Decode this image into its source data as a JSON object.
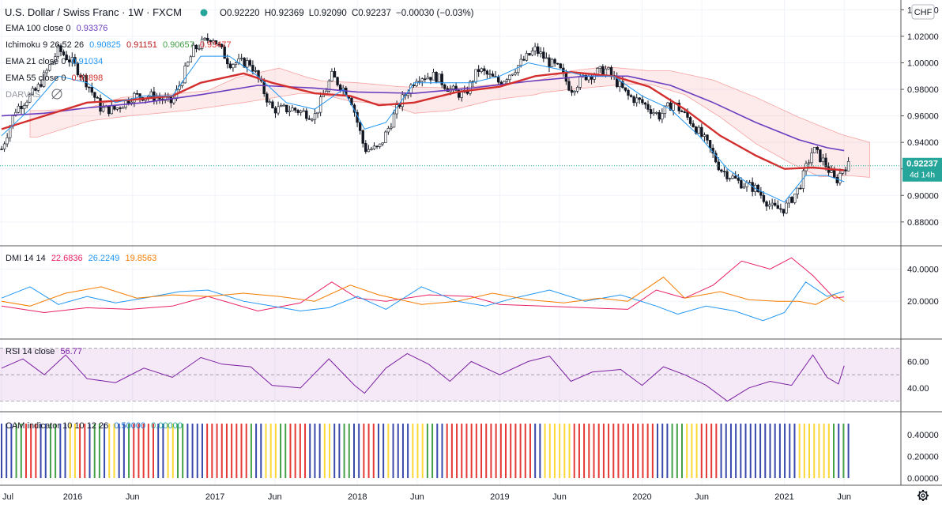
{
  "header": {
    "symbol": "U.S. Dollar / Swiss Franc · 1W · FXCM",
    "ohlc": {
      "o": "O0.92220",
      "h": "H0.92369",
      "l": "L0.92090",
      "c": "C0.92237",
      "change": "−0.00030 (−0.03%)"
    },
    "currency_badge": "CHF",
    "status_dot_color": "#26a69a"
  },
  "legends": {
    "ema100": {
      "label": "EMA 100 close 0",
      "value": "0.93376",
      "color": "#6a3dbf"
    },
    "ichimoku": {
      "label": "Ichimoku 9 26 52 26",
      "values": [
        "0.90825",
        "0.91151",
        "0.90657",
        "0.93477"
      ],
      "colors": [
        "#2196f3",
        "#b71c1c",
        "#43a047",
        "#e53935"
      ]
    },
    "ema21": {
      "label": "EMA 21 close 0",
      "value": "0.91034",
      "color": "#2196f3"
    },
    "ema55": {
      "label": "EMA 55 close 0",
      "value": "0.91898",
      "color": "#d32f2f"
    },
    "darvas": {
      "label": "DARVAS"
    },
    "dmi": {
      "label": "DMI 14 14",
      "values": [
        "22.6836",
        "26.2249",
        "19.8563"
      ],
      "colors": [
        "#e91e63",
        "#2196f3",
        "#f57c00"
      ]
    },
    "rsi": {
      "label": "RSI 14 close",
      "value": "56.77",
      "color": "#7b1fa2"
    },
    "cam": {
      "label": "CAM indicator 10 10 12 26",
      "values": [
        "0.50000",
        "0.00000"
      ],
      "colors": [
        "#1976d2",
        "#26a69a"
      ]
    }
  },
  "price_marker": {
    "value": "0.92237",
    "countdown": "4d 14h",
    "color": "#26a69a"
  },
  "x_axis": {
    "labels": [
      "Jul",
      "2016",
      "Jun",
      "2017",
      "Jun",
      "2018",
      "Jun",
      "2019",
      "Jun",
      "2020",
      "Jun",
      "2021",
      "Jun"
    ]
  },
  "settings_icon": "gear-icon",
  "chart_data": [
    {
      "type": "line",
      "panel": "price",
      "title": "U.S. Dollar / Swiss Franc · 1W · FXCM",
      "ylim": [
        0.865,
        1.045
      ],
      "y_ticks": [
        "1.04000",
        "1.02000",
        "1.00000",
        "0.98000",
        "0.96000",
        "0.94000",
        "0.92000",
        "0.90000",
        "0.88000"
      ],
      "y_tick_values": [
        1.04,
        1.02,
        1.0,
        0.98,
        0.96,
        0.94,
        0.92,
        0.9,
        0.88
      ],
      "time_anchors": [
        2015.5,
        2016.0,
        2016.42,
        2017.0,
        2017.42,
        2018.0,
        2018.42,
        2019.0,
        2019.42,
        2020.0,
        2020.42,
        2021.0,
        2021.42
      ],
      "time_range": [
        2015.5,
        2021.45
      ],
      "close": [
        [
          2015.5,
          0.935
        ],
        [
          2015.6,
          0.965
        ],
        [
          2015.75,
          0.98
        ],
        [
          2015.9,
          1.01
        ],
        [
          2016.0,
          1.0
        ],
        [
          2016.1,
          0.985
        ],
        [
          2016.2,
          0.965
        ],
        [
          2016.3,
          0.965
        ],
        [
          2016.42,
          0.975
        ],
        [
          2016.55,
          0.975
        ],
        [
          2016.7,
          0.97
        ],
        [
          2016.85,
          1.01
        ],
        [
          2016.98,
          1.02
        ],
        [
          2017.1,
          1.0
        ],
        [
          2017.25,
          1.0
        ],
        [
          2017.4,
          0.965
        ],
        [
          2017.55,
          0.965
        ],
        [
          2017.7,
          0.96
        ],
        [
          2017.82,
          0.99
        ],
        [
          2017.95,
          0.975
        ],
        [
          2018.05,
          0.935
        ],
        [
          2018.15,
          0.935
        ],
        [
          2018.3,
          0.97
        ],
        [
          2018.42,
          0.99
        ],
        [
          2018.55,
          0.99
        ],
        [
          2018.65,
          0.98
        ],
        [
          2018.75,
          0.975
        ],
        [
          2018.85,
          0.995
        ],
        [
          2019.0,
          0.985
        ],
        [
          2019.1,
          0.995
        ],
        [
          2019.25,
          1.01
        ],
        [
          2019.35,
          1.0
        ],
        [
          2019.42,
          0.995
        ],
        [
          2019.5,
          0.98
        ],
        [
          2019.6,
          0.99
        ],
        [
          2019.75,
          0.995
        ],
        [
          2019.9,
          0.975
        ],
        [
          2020.0,
          0.97
        ],
        [
          2020.12,
          0.96
        ],
        [
          2020.22,
          0.97
        ],
        [
          2020.35,
          0.955
        ],
        [
          2020.45,
          0.94
        ],
        [
          2020.55,
          0.92
        ],
        [
          2020.68,
          0.91
        ],
        [
          2020.8,
          0.905
        ],
        [
          2020.92,
          0.89
        ],
        [
          2021.0,
          0.89
        ],
        [
          2021.1,
          0.905
        ],
        [
          2021.2,
          0.935
        ],
        [
          2021.28,
          0.925
        ],
        [
          2021.36,
          0.91
        ],
        [
          2021.42,
          0.92237
        ]
      ],
      "ema21": [
        [
          2015.5,
          0.945
        ],
        [
          2015.7,
          0.965
        ],
        [
          2015.9,
          0.99
        ],
        [
          2016.1,
          0.985
        ],
        [
          2016.3,
          0.97
        ],
        [
          2016.5,
          0.975
        ],
        [
          2016.7,
          0.975
        ],
        [
          2016.9,
          1.005
        ],
        [
          2017.1,
          1.005
        ],
        [
          2017.3,
          0.99
        ],
        [
          2017.5,
          0.97
        ],
        [
          2017.7,
          0.965
        ],
        [
          2017.9,
          0.98
        ],
        [
          2018.05,
          0.95
        ],
        [
          2018.2,
          0.955
        ],
        [
          2018.4,
          0.985
        ],
        [
          2018.6,
          0.985
        ],
        [
          2018.8,
          0.985
        ],
        [
          2019.0,
          0.99
        ],
        [
          2019.2,
          1.0
        ],
        [
          2019.42,
          0.995
        ],
        [
          2019.6,
          0.99
        ],
        [
          2019.8,
          0.99
        ],
        [
          2020.0,
          0.975
        ],
        [
          2020.2,
          0.965
        ],
        [
          2020.4,
          0.945
        ],
        [
          2020.6,
          0.92
        ],
        [
          2020.8,
          0.905
        ],
        [
          2021.0,
          0.895
        ],
        [
          2021.15,
          0.915
        ],
        [
          2021.3,
          0.915
        ],
        [
          2021.42,
          0.91034
        ]
      ],
      "ema55": [
        [
          2015.5,
          0.95
        ],
        [
          2015.8,
          0.96
        ],
        [
          2016.1,
          0.97
        ],
        [
          2016.4,
          0.972
        ],
        [
          2016.7,
          0.975
        ],
        [
          2016.9,
          0.985
        ],
        [
          2017.2,
          0.992
        ],
        [
          2017.4,
          0.985
        ],
        [
          2017.7,
          0.977
        ],
        [
          2017.95,
          0.975
        ],
        [
          2018.15,
          0.968
        ],
        [
          2018.4,
          0.97
        ],
        [
          2018.7,
          0.978
        ],
        [
          2019.0,
          0.982
        ],
        [
          2019.25,
          0.99
        ],
        [
          2019.5,
          0.993
        ],
        [
          2019.8,
          0.99
        ],
        [
          2020.05,
          0.982
        ],
        [
          2020.3,
          0.965
        ],
        [
          2020.55,
          0.945
        ],
        [
          2020.8,
          0.93
        ],
        [
          2021.0,
          0.92
        ],
        [
          2021.2,
          0.921
        ],
        [
          2021.42,
          0.91898
        ]
      ],
      "ema100": [
        [
          2015.5,
          0.96
        ],
        [
          2015.8,
          0.962
        ],
        [
          2016.1,
          0.966
        ],
        [
          2016.5,
          0.97
        ],
        [
          2016.9,
          0.976
        ],
        [
          2017.3,
          0.983
        ],
        [
          2017.7,
          0.981
        ],
        [
          2018.0,
          0.978
        ],
        [
          2018.4,
          0.977
        ],
        [
          2018.8,
          0.981
        ],
        [
          2019.2,
          0.986
        ],
        [
          2019.6,
          0.99
        ],
        [
          2019.9,
          0.99
        ],
        [
          2020.2,
          0.983
        ],
        [
          2020.5,
          0.97
        ],
        [
          2020.8,
          0.955
        ],
        [
          2021.1,
          0.942
        ],
        [
          2021.3,
          0.936
        ],
        [
          2021.42,
          0.93376
        ]
      ]
    },
    {
      "type": "line",
      "panel": "dmi",
      "title": "DMI 14 14",
      "ylim": [
        0,
        52
      ],
      "y_ticks": [
        "40.0000",
        "20.0000"
      ],
      "y_tick_values": [
        40,
        20
      ],
      "series": [
        {
          "name": "22.6836",
          "color": "#e91e63",
          "values": [
            [
              2015.5,
              17
            ],
            [
              2015.8,
              13
            ],
            [
              2016.1,
              16
            ],
            [
              2016.4,
              15
            ],
            [
              2016.7,
              17
            ],
            [
              2016.95,
              23
            ],
            [
              2017.3,
              14
            ],
            [
              2017.6,
              19
            ],
            [
              2017.82,
              32
            ],
            [
              2018.0,
              22
            ],
            [
              2018.2,
              20
            ],
            [
              2018.5,
              24
            ],
            [
              2018.8,
              23
            ],
            [
              2019.0,
              18
            ],
            [
              2019.3,
              17
            ],
            [
              2019.6,
              16
            ],
            [
              2019.9,
              15
            ],
            [
              2020.1,
              27
            ],
            [
              2020.3,
              22
            ],
            [
              2020.5,
              30
            ],
            [
              2020.7,
              45
            ],
            [
              2020.9,
              40
            ],
            [
              2021.05,
              47
            ],
            [
              2021.2,
              36
            ],
            [
              2021.35,
              22
            ],
            [
              2021.42,
              22.68
            ]
          ]
        },
        {
          "name": "26.2249",
          "color": "#2196f3",
          "values": [
            [
              2015.5,
              22
            ],
            [
              2015.7,
              29
            ],
            [
              2015.9,
              18
            ],
            [
              2016.1,
              23
            ],
            [
              2016.3,
              19
            ],
            [
              2016.5,
              22
            ],
            [
              2016.75,
              26
            ],
            [
              2016.95,
              27
            ],
            [
              2017.2,
              20
            ],
            [
              2017.4,
              17
            ],
            [
              2017.6,
              14
            ],
            [
              2017.8,
              16
            ],
            [
              2018.0,
              23
            ],
            [
              2018.2,
              15
            ],
            [
              2018.45,
              29
            ],
            [
              2018.7,
              20
            ],
            [
              2018.9,
              17
            ],
            [
              2019.1,
              22
            ],
            [
              2019.35,
              27
            ],
            [
              2019.6,
              20
            ],
            [
              2019.85,
              24
            ],
            [
              2020.1,
              17
            ],
            [
              2020.25,
              12
            ],
            [
              2020.45,
              17
            ],
            [
              2020.65,
              14
            ],
            [
              2020.85,
              8
            ],
            [
              2021.0,
              13
            ],
            [
              2021.15,
              32
            ],
            [
              2021.3,
              23
            ],
            [
              2021.42,
              26.22
            ]
          ]
        },
        {
          "name": "19.8563",
          "color": "#f57c00",
          "values": [
            [
              2015.5,
              20
            ],
            [
              2015.7,
              17
            ],
            [
              2015.95,
              25
            ],
            [
              2016.2,
              29
            ],
            [
              2016.45,
              22
            ],
            [
              2016.7,
              24
            ],
            [
              2016.95,
              23
            ],
            [
              2017.2,
              25
            ],
            [
              2017.45,
              23
            ],
            [
              2017.7,
              20
            ],
            [
              2017.95,
              30
            ],
            [
              2018.15,
              24
            ],
            [
              2018.45,
              18
            ],
            [
              2018.7,
              20
            ],
            [
              2018.95,
              25
            ],
            [
              2019.2,
              21
            ],
            [
              2019.45,
              19
            ],
            [
              2019.7,
              22
            ],
            [
              2019.9,
              20
            ],
            [
              2020.15,
              35
            ],
            [
              2020.3,
              22
            ],
            [
              2020.55,
              26
            ],
            [
              2020.75,
              21
            ],
            [
              2020.95,
              20
            ],
            [
              2021.1,
              20
            ],
            [
              2021.22,
              18
            ],
            [
              2021.35,
              24
            ],
            [
              2021.42,
              19.86
            ]
          ]
        }
      ]
    },
    {
      "type": "line",
      "panel": "rsi",
      "title": "RSI 14 close",
      "ylim": [
        25,
        74
      ],
      "y_ticks": [
        "60.00",
        "40.00"
      ],
      "y_tick_values": [
        60,
        40
      ],
      "band": [
        30,
        70
      ],
      "series": [
        {
          "name": "56.77",
          "color": "#7b1fa2",
          "values": [
            [
              2015.5,
              55
            ],
            [
              2015.65,
              62
            ],
            [
              2015.8,
              50
            ],
            [
              2015.95,
              65
            ],
            [
              2016.1,
              47
            ],
            [
              2016.3,
              44
            ],
            [
              2016.5,
              55
            ],
            [
              2016.7,
              48
            ],
            [
              2016.9,
              63
            ],
            [
              2017.05,
              58
            ],
            [
              2017.25,
              56
            ],
            [
              2017.4,
              42
            ],
            [
              2017.6,
              40
            ],
            [
              2017.8,
              62
            ],
            [
              2017.98,
              42
            ],
            [
              2018.05,
              36
            ],
            [
              2018.2,
              55
            ],
            [
              2018.35,
              66
            ],
            [
              2018.5,
              58
            ],
            [
              2018.65,
              45
            ],
            [
              2018.8,
              60
            ],
            [
              2019.0,
              50
            ],
            [
              2019.2,
              60
            ],
            [
              2019.35,
              64
            ],
            [
              2019.5,
              45
            ],
            [
              2019.65,
              52
            ],
            [
              2019.85,
              54
            ],
            [
              2020.0,
              42
            ],
            [
              2020.15,
              56
            ],
            [
              2020.3,
              50
            ],
            [
              2020.45,
              42
            ],
            [
              2020.6,
              30
            ],
            [
              2020.75,
              40
            ],
            [
              2020.9,
              45
            ],
            [
              2021.05,
              42
            ],
            [
              2021.2,
              65
            ],
            [
              2021.3,
              48
            ],
            [
              2021.38,
              43
            ],
            [
              2021.42,
              56.77
            ]
          ]
        }
      ]
    },
    {
      "type": "bar",
      "panel": "cam",
      "title": "CAM indicator 10 10 12 26",
      "ylim": [
        0,
        0.5
      ],
      "y_ticks": [
        "0.40000",
        "0.20000",
        "0.00000"
      ],
      "y_tick_values": [
        0.4,
        0.2,
        0.0
      ],
      "bar_value": 0.5,
      "palette": {
        "blue": "#3949ab",
        "green": "#43a047",
        "red": "#e53935",
        "yellow": "#fdd835"
      },
      "color_sequence": "BBBGGRRRBBGGBBYYRRBGGBYYBBGRRRRRBBYYGGBBBBRRRRRRRRRGBBYYYGGRRRRBBBYYBBGGBBRRRBBYBBBBYYYGGBBRRRRRRRRRRRRRRRRRRBBYYYYYYRRRRRRRRRRRRRRRRRBBBGGGYYYRRRRBBBBBBBBBBBBBBBBYYYYYYYGBGB"
    }
  ]
}
